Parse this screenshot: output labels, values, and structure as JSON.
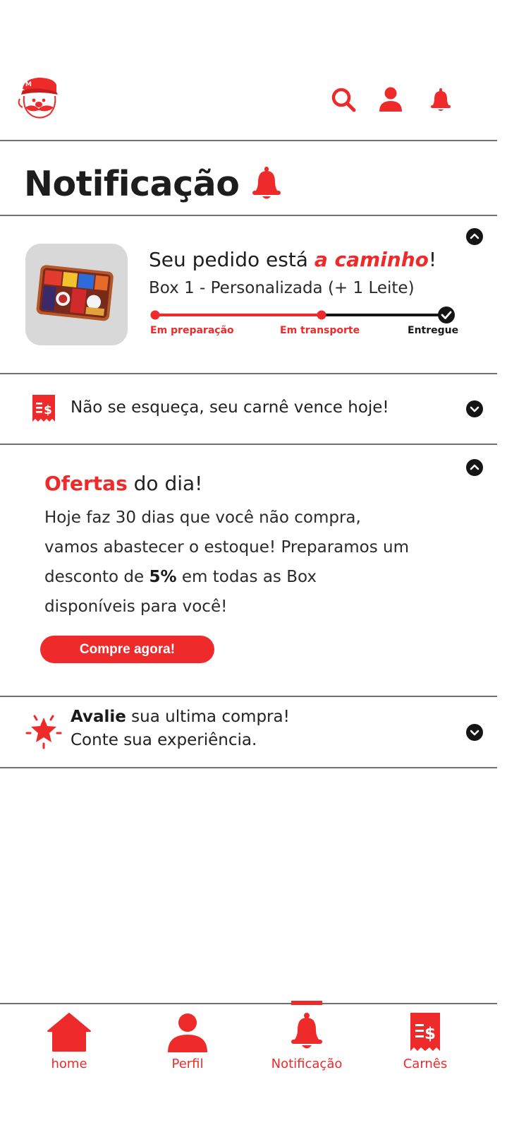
{
  "colors": {
    "accent": "#ee2a2a",
    "text": "#1f1f1f",
    "divider": "#6f6f6f"
  },
  "header": {
    "logo": "mascot-logo",
    "icons": [
      "search-icon",
      "user-icon",
      "bell-icon"
    ]
  },
  "page": {
    "title": "Notificação",
    "title_icon": "bell-icon"
  },
  "order": {
    "headline_prefix": "Seu pedido está ",
    "headline_highlight": "a caminho",
    "headline_suffix": "!",
    "product": "Box 1 - Personalizada (+ 1 Leite)",
    "steps": [
      "Em preparação",
      "Em transporte",
      "Entregue"
    ],
    "current_step": 2,
    "expanded": true
  },
  "carne_reminder": {
    "text": "Não se esqueça, seu carnê vence hoje!",
    "expanded": false
  },
  "offer": {
    "title_highlight": "Ofertas",
    "title_rest": " do dia!",
    "body_before": "Hoje faz 30 dias que você não compra, vamos abastecer o estoque! Preparamos um desconto de ",
    "body_bold": "5%",
    "body_after": " em todas as Box disponíveis para você!",
    "button": "Compre agora!",
    "expanded": true
  },
  "review": {
    "line1_bold": "Avalie",
    "line1_rest": " sua ultima compra!",
    "line2": "Conte sua experiência.",
    "expanded": false
  },
  "bottom_nav": {
    "active": "Notificação",
    "items": [
      {
        "label": "home",
        "icon": "home-icon"
      },
      {
        "label": "Perfil",
        "icon": "user-icon"
      },
      {
        "label": "Notificação",
        "icon": "bell-icon"
      },
      {
        "label": "Carnês",
        "icon": "receipt-icon"
      }
    ]
  }
}
